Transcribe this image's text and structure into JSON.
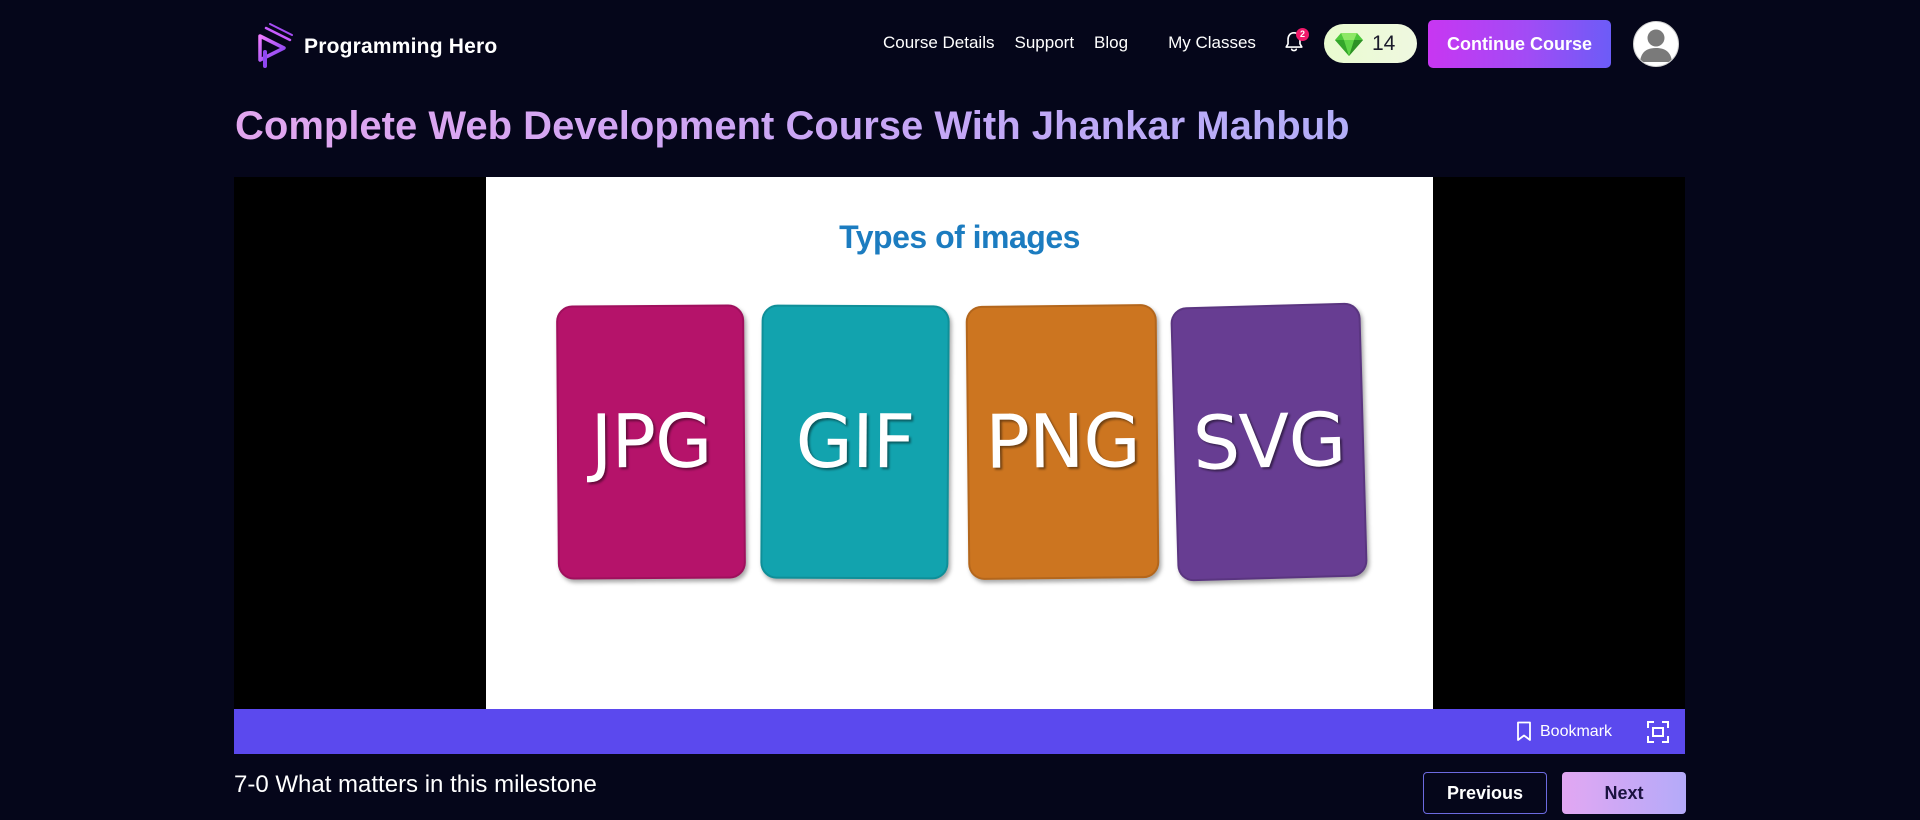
{
  "nav": {
    "brand_name": "Programming Hero",
    "links": [
      "Course Details",
      "Support",
      "Blog",
      "My Classes"
    ],
    "notification_count": "2",
    "gem_count": "14",
    "continue_label": "Continue Course"
  },
  "course": {
    "title": "Complete Web Development Course With Jhankar Mahbub"
  },
  "video": {
    "slide_title": "Types of images",
    "cards": [
      {
        "label": "JPG",
        "color": "#b5136a"
      },
      {
        "label": "GIF",
        "color": "#12a3ae"
      },
      {
        "label": "PNG",
        "color": "#cc7520"
      },
      {
        "label": "SVG",
        "color": "#673d92"
      }
    ]
  },
  "controls": {
    "bookmark_label": "Bookmark",
    "bar_color": "#5b49ee"
  },
  "lesson": {
    "title": "7-0 What matters in this milestone",
    "previous_label": "Previous",
    "next_label": "Next"
  },
  "icons": {
    "logo": "programming-hero-logo",
    "bell": "bell-icon",
    "gem": "gem-icon",
    "avatar": "user-avatar",
    "bookmark": "bookmark-icon",
    "fullscreen": "fullscreen-icon"
  }
}
